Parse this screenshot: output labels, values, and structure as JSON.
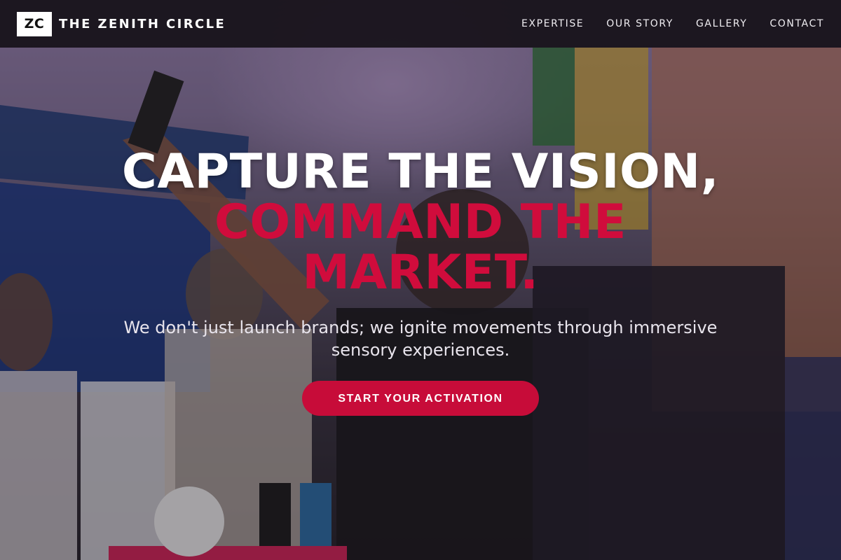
{
  "brand": {
    "logo_text": "ZC",
    "name": "THE ZENITH CIRCLE"
  },
  "nav": {
    "links": [
      "EXPERTISE",
      "OUR STORY",
      "GALLERY",
      "CONTACT"
    ]
  },
  "hero": {
    "headline_white": "CAPTURE THE VISION,",
    "headline_red": "COMMAND THE MARKET.",
    "subtext": "We don't just launch brands; we ignite movements through immersive sensory experiences.",
    "cta_label": "START YOUR ACTIVATION"
  },
  "colors": {
    "accent": "#c70c39",
    "nav_background": "#141016"
  }
}
